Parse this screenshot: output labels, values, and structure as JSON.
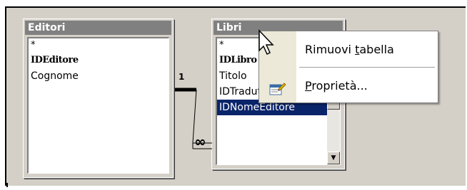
{
  "tables": [
    {
      "title": "Editori",
      "fields": [
        "*",
        "IDEditore",
        "Cognome"
      ]
    },
    {
      "title": "Libri",
      "fields": [
        "*",
        "IDLibro",
        "Titolo",
        "IDTraduttore",
        "IDNomeEditore"
      ]
    }
  ],
  "relationship": {
    "one_label": "1",
    "many_label": "∞"
  },
  "context_menu": {
    "items": [
      {
        "label": "Rimuovi tabella",
        "before": "Rimuovi ",
        "accel": "t",
        "after": "abella",
        "icon": null
      },
      {
        "label": "Proprietà...",
        "before": "",
        "accel": "P",
        "after": "roprietà...",
        "icon": "properties-icon"
      }
    ]
  },
  "colors": {
    "title_inactive": "#808080",
    "selection": "#0a246a",
    "workspace": "#d4d0c8"
  }
}
